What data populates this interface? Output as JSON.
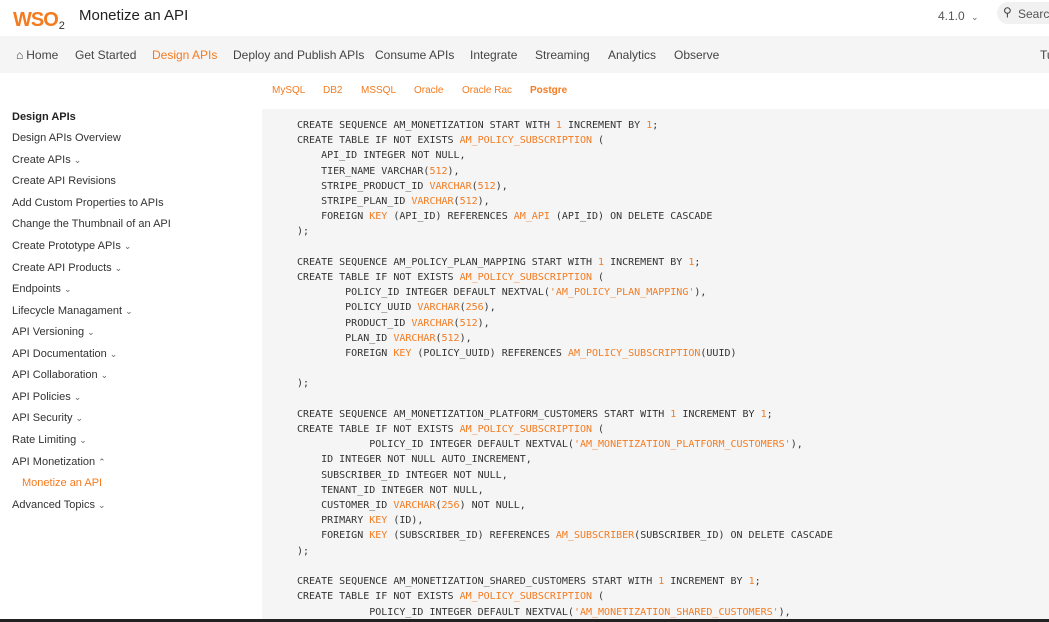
{
  "header": {
    "logo_text": "WSO",
    "logo_sub": "2",
    "page_title": "Monetize an API",
    "version": "4.1.0",
    "version_chevron": "⌄",
    "search_placeholder": "Search",
    "search_icon": "search-icon"
  },
  "nav": {
    "items": [
      {
        "label": "Home",
        "icon": "home-icon"
      },
      {
        "label": "Get Started"
      },
      {
        "label": "Design APIs",
        "active": true
      },
      {
        "label": "Deploy and Publish APIs"
      },
      {
        "label": "Consume APIs"
      },
      {
        "label": "Integrate"
      },
      {
        "label": "Streaming"
      },
      {
        "label": "Analytics"
      },
      {
        "label": "Observe"
      },
      {
        "label": "Tu"
      }
    ]
  },
  "db_tabs": [
    "MySQL",
    "DB2",
    "MSSQL",
    "Oracle",
    "Oracle Rac",
    "Postgre"
  ],
  "sidebar": {
    "items": [
      {
        "label": "Design APIs",
        "type": "heading"
      },
      {
        "label": "Design APIs Overview"
      },
      {
        "label": "Create APIs",
        "chevron": "⌄"
      },
      {
        "label": "Create API Revisions"
      },
      {
        "label": "Add Custom Properties to APIs"
      },
      {
        "label": "Change the Thumbnail of an API"
      },
      {
        "label": "Create Prototype APIs",
        "chevron": "⌄"
      },
      {
        "label": "Create API Products",
        "chevron": "⌄"
      },
      {
        "label": "Endpoints",
        "chevron": "⌄"
      },
      {
        "label": "Lifecycle Managament",
        "chevron": "⌄"
      },
      {
        "label": "API Versioning",
        "chevron": "⌄"
      },
      {
        "label": "API Documentation",
        "chevron": "⌄"
      },
      {
        "label": "API Collaboration",
        "chevron": "⌄"
      },
      {
        "label": "API Policies",
        "chevron": "⌄"
      },
      {
        "label": "API Security",
        "chevron": "⌄"
      },
      {
        "label": "Rate Limiting",
        "chevron": "⌄"
      },
      {
        "label": "API Monetization",
        "chevron": "⌃"
      },
      {
        "label": "Monetize an API",
        "type": "active-sub"
      },
      {
        "label": "Advanced Topics",
        "chevron": "⌄"
      }
    ]
  },
  "code": {
    "lines": [
      [
        [
          "CREATE SEQUENCE AM_MONETIZATION START WITH ",
          0
        ],
        [
          "1",
          1
        ],
        [
          " INCREMENT BY ",
          0
        ],
        [
          "1",
          1
        ],
        [
          ";",
          0
        ]
      ],
      [
        [
          "CREATE TABLE IF NOT EXISTS ",
          0
        ],
        [
          "AM_POLICY_SUBSCRIPTION",
          1
        ],
        [
          " (",
          0
        ]
      ],
      [
        [
          "    API_ID INTEGER NOT NULL,",
          0
        ]
      ],
      [
        [
          "    TIER_NAME VARCHAR(",
          0
        ],
        [
          "512",
          1
        ],
        [
          "),",
          0
        ]
      ],
      [
        [
          "    STRIPE_PRODUCT_ID ",
          0
        ],
        [
          "VARCHAR",
          1
        ],
        [
          "(",
          0
        ],
        [
          "512",
          1
        ],
        [
          "),",
          0
        ]
      ],
      [
        [
          "    STRIPE_PLAN_ID ",
          0
        ],
        [
          "VARCHAR",
          1
        ],
        [
          "(",
          0
        ],
        [
          "512",
          1
        ],
        [
          "),",
          0
        ]
      ],
      [
        [
          "    FOREIGN ",
          0
        ],
        [
          "KEY",
          1
        ],
        [
          " (API_ID) REFERENCES ",
          0
        ],
        [
          "AM_API",
          1
        ],
        [
          " (API_ID) ON DELETE CASCADE",
          0
        ]
      ],
      [
        [
          ");",
          0
        ]
      ],
      [
        [
          "",
          0
        ]
      ],
      [
        [
          "CREATE SEQUENCE AM_POLICY_PLAN_MAPPING START WITH ",
          0
        ],
        [
          "1",
          1
        ],
        [
          " INCREMENT BY ",
          0
        ],
        [
          "1",
          1
        ],
        [
          ";",
          0
        ]
      ],
      [
        [
          "CREATE TABLE IF NOT EXISTS ",
          0
        ],
        [
          "AM_POLICY_SUBSCRIPTION",
          1
        ],
        [
          " (",
          0
        ]
      ],
      [
        [
          "        POLICY_ID INTEGER DEFAULT NEXTVAL(",
          0
        ],
        [
          "'AM_POLICY_PLAN_MAPPING'",
          1
        ],
        [
          "),",
          0
        ]
      ],
      [
        [
          "        POLICY_UUID ",
          0
        ],
        [
          "VARCHAR",
          1
        ],
        [
          "(",
          0
        ],
        [
          "256",
          1
        ],
        [
          "),",
          0
        ]
      ],
      [
        [
          "        PRODUCT_ID ",
          0
        ],
        [
          "VARCHAR",
          1
        ],
        [
          "(",
          0
        ],
        [
          "512",
          1
        ],
        [
          "),",
          0
        ]
      ],
      [
        [
          "        PLAN_ID ",
          0
        ],
        [
          "VARCHAR",
          1
        ],
        [
          "(",
          0
        ],
        [
          "512",
          1
        ],
        [
          "),",
          0
        ]
      ],
      [
        [
          "        FOREIGN ",
          0
        ],
        [
          "KEY",
          1
        ],
        [
          " (POLICY_UUID) REFERENCES ",
          0
        ],
        [
          "AM_POLICY_SUBSCRIPTION",
          1
        ],
        [
          "(UUID)",
          0
        ]
      ],
      [
        [
          "",
          0
        ]
      ],
      [
        [
          ");",
          0
        ]
      ],
      [
        [
          "",
          0
        ]
      ],
      [
        [
          "CREATE SEQUENCE AM_MONETIZATION_PLATFORM_CUSTOMERS START WITH ",
          0
        ],
        [
          "1",
          1
        ],
        [
          " INCREMENT BY ",
          0
        ],
        [
          "1",
          1
        ],
        [
          ";",
          0
        ]
      ],
      [
        [
          "CREATE TABLE IF NOT EXISTS ",
          0
        ],
        [
          "AM_POLICY_SUBSCRIPTION",
          1
        ],
        [
          " (",
          0
        ]
      ],
      [
        [
          "            POLICY_ID INTEGER DEFAULT NEXTVAL(",
          0
        ],
        [
          "'AM_MONETIZATION_PLATFORM_CUSTOMERS'",
          1
        ],
        [
          "),",
          0
        ]
      ],
      [
        [
          "    ID INTEGER NOT NULL AUTO_INCREMENT,",
          0
        ]
      ],
      [
        [
          "    SUBSCRIBER_ID INTEGER NOT NULL,",
          0
        ]
      ],
      [
        [
          "    TENANT_ID INTEGER NOT NULL,",
          0
        ]
      ],
      [
        [
          "    CUSTOMER_ID ",
          0
        ],
        [
          "VARCHAR",
          1
        ],
        [
          "(",
          0
        ],
        [
          "256",
          1
        ],
        [
          ") NOT NULL,",
          0
        ]
      ],
      [
        [
          "    PRIMARY ",
          0
        ],
        [
          "KEY",
          1
        ],
        [
          " (ID),",
          0
        ]
      ],
      [
        [
          "    FOREIGN ",
          0
        ],
        [
          "KEY",
          1
        ],
        [
          " (SUBSCRIBER_ID) REFERENCES ",
          0
        ],
        [
          "AM_SUBSCRIBER",
          1
        ],
        [
          "(SUBSCRIBER_ID) ON DELETE CASCADE",
          0
        ]
      ],
      [
        [
          ");",
          0
        ]
      ],
      [
        [
          "",
          0
        ]
      ],
      [
        [
          "CREATE SEQUENCE AM_MONETIZATION_SHARED_CUSTOMERS START WITH ",
          0
        ],
        [
          "1",
          1
        ],
        [
          " INCREMENT BY ",
          0
        ],
        [
          "1",
          1
        ],
        [
          ";",
          0
        ]
      ],
      [
        [
          "CREATE TABLE IF NOT EXISTS ",
          0
        ],
        [
          "AM_POLICY_SUBSCRIPTION",
          1
        ],
        [
          " (",
          0
        ]
      ],
      [
        [
          "            POLICY_ID INTEGER DEFAULT NEXTVAL(",
          0
        ],
        [
          "'AM_MONETIZATION_SHARED_CUSTOMERS'",
          1
        ],
        [
          "),",
          0
        ]
      ]
    ]
  },
  "colors": {
    "accent": "#f47b20",
    "nav_bg": "#f5f5f5",
    "code_bg": "#f5f5f5"
  }
}
